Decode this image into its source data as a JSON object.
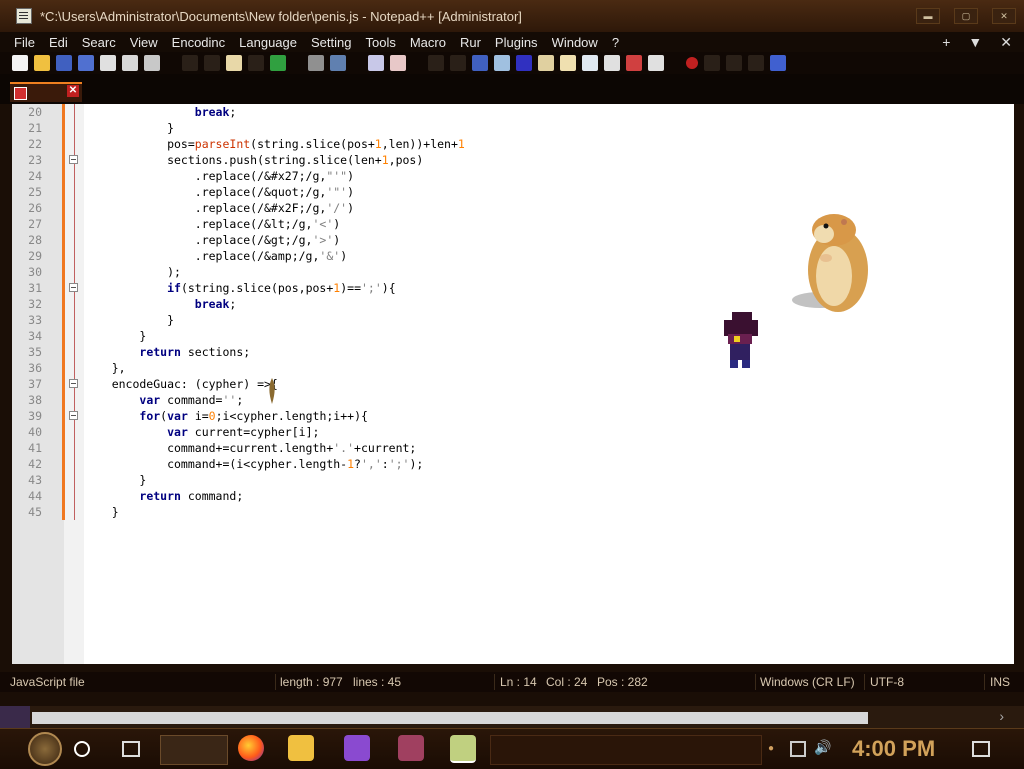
{
  "window": {
    "title": "*C:\\Users\\Administrator\\Documents\\New folder\\penis.js - Notepad++ [Administrator]",
    "buttons": [
      "minimize",
      "maximize",
      "close"
    ]
  },
  "menu": {
    "items": [
      "File",
      "Edi",
      "Searc",
      "View",
      "Encodinc",
      "Language",
      "Setting",
      "Tools",
      "Macro",
      "Rur",
      "Plugins",
      "Window",
      "?"
    ],
    "right_plus": "+",
    "right_arrow": "▼",
    "right_close": "✕"
  },
  "tab": {
    "close_label": "✕"
  },
  "editor": {
    "lines": [
      {
        "n": "20",
        "fold": false,
        "html": "                <span class=\"kw\">break</span>;"
      },
      {
        "n": "21",
        "fold": false,
        "html": "            }"
      },
      {
        "n": "22",
        "fold": false,
        "html": "            pos=<span class=\"fn\">parseInt</span>(string.slice(pos+<span class=\"nm\">1</span>,len))+len+<span class=\"nm\">1</span>"
      },
      {
        "n": "23",
        "fold": true,
        "html": "            sections.push(string.slice(len+<span class=\"nm\">1</span>,pos)"
      },
      {
        "n": "24",
        "fold": false,
        "html": "                .replace(/&amp;#x27;/g,<span class=\"st\">\"'\"</span>)"
      },
      {
        "n": "25",
        "fold": false,
        "html": "                .replace(/&amp;quot;/g,<span class=\"st\">'\"'</span>)"
      },
      {
        "n": "26",
        "fold": false,
        "html": "                .replace(/&amp;#x2F;/g,<span class=\"st\">'/'</span>)"
      },
      {
        "n": "27",
        "fold": false,
        "html": "                .replace(/&amp;lt;/g,<span class=\"st\">'&lt;'</span>)"
      },
      {
        "n": "28",
        "fold": false,
        "html": "                .replace(/&amp;gt;/g,<span class=\"st\">'&gt;'</span>)"
      },
      {
        "n": "29",
        "fold": false,
        "html": "                .replace(/&amp;amp;/g,<span class=\"st\">'&amp;'</span>)"
      },
      {
        "n": "30",
        "fold": false,
        "html": "            );"
      },
      {
        "n": "31",
        "fold": true,
        "html": "            <span class=\"kw\">if</span>(string.slice(pos,pos+<span class=\"nm\">1</span>)==<span class=\"st\">';'</span>){"
      },
      {
        "n": "32",
        "fold": false,
        "html": "                <span class=\"kw\">break</span>;"
      },
      {
        "n": "33",
        "fold": false,
        "html": "            }"
      },
      {
        "n": "34",
        "fold": false,
        "html": "        }"
      },
      {
        "n": "35",
        "fold": false,
        "html": "        <span class=\"kw\">return</span> sections;"
      },
      {
        "n": "36",
        "fold": false,
        "html": "    },"
      },
      {
        "n": "37",
        "fold": true,
        "html": "    encodeGuac: (cypher) =&gt;{"
      },
      {
        "n": "38",
        "fold": false,
        "html": "        <span class=\"kw\">var</span> command=<span class=\"st\">''</span>;"
      },
      {
        "n": "39",
        "fold": true,
        "html": "        <span class=\"kw\">for</span>(<span class=\"kw\">var</span> i=<span class=\"nm\">0</span>;i&lt;cypher.length;i++){"
      },
      {
        "n": "40",
        "fold": false,
        "html": "            <span class=\"kw\">var</span> current=cypher[i];"
      },
      {
        "n": "41",
        "fold": false,
        "html": "            command+=current.length+<span class=\"st\">'.'</span>+current;"
      },
      {
        "n": "42",
        "fold": false,
        "html": "            command+=(i&lt;cypher.length-<span class=\"nm\">1</span>?<span class=\"st\">','</span>:<span class=\"st\">';'</span>);"
      },
      {
        "n": "43",
        "fold": false,
        "html": "        }"
      },
      {
        "n": "44",
        "fold": false,
        "html": "        <span class=\"kw\">return</span> command;"
      },
      {
        "n": "45",
        "fold": false,
        "html": "    }"
      }
    ]
  },
  "status": {
    "filetype": "JavaScript file",
    "length": "length : 977",
    "lines": "lines : 45",
    "ln": "Ln : 14",
    "col": "Col : 24",
    "pos": "Pos : 282",
    "eol": "Windows (CR LF)",
    "encoding": "UTF-8",
    "mode": "INS"
  },
  "taskbar": {
    "clock": "4:00 PM",
    "apps": [
      "firefox-icon",
      "file-explorer-icon",
      "visual-studio-icon",
      "game-character-icon",
      "notepad-plus-plus-icon"
    ]
  },
  "colors": {
    "accent": "#f07820",
    "keyword": "#000080",
    "function": "#cc3300",
    "number": "#ff8000",
    "string": "#7f7f7f",
    "clock": "#d2a25a"
  }
}
